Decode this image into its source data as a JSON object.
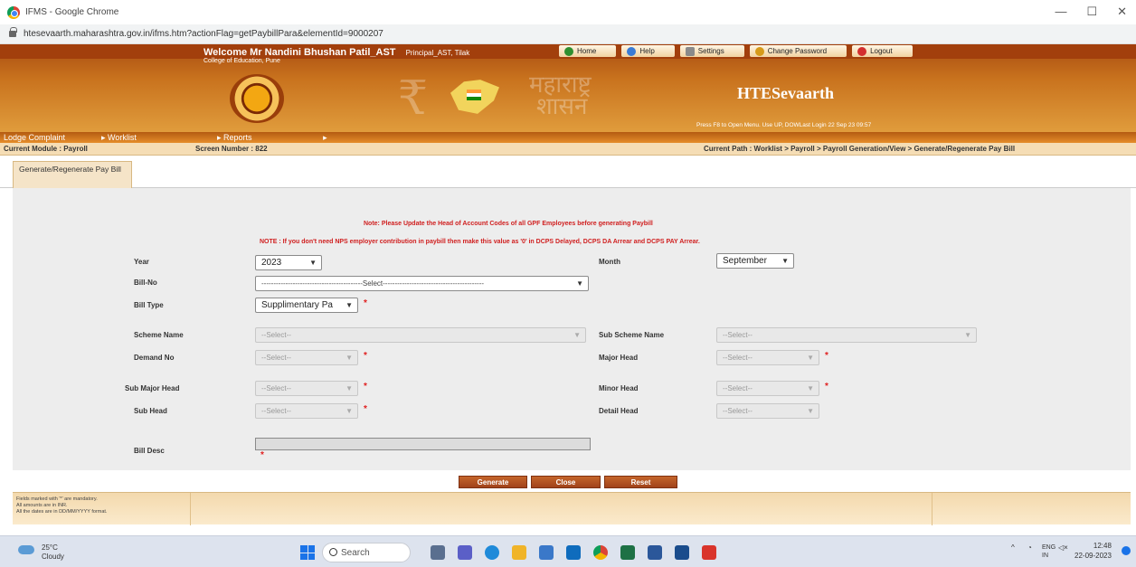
{
  "browser": {
    "window_title": "IFMS - Google Chrome",
    "url": "htesevaarth.maharashtra.gov.in/ifms.htm?actionFlag=getPaybillPara&elementId=9000207",
    "controls": [
      "—",
      "☐",
      "✕"
    ]
  },
  "header": {
    "welcome": "Welcome Mr Nandini Bhushan Patil_AST",
    "role": "Principal_AST, Tilak",
    "college": "College of Education, Pune",
    "deva_line1": "महाराष्ट्र",
    "deva_line2": "शासन",
    "brand": "HTESevaarth",
    "press_note": "Press F8 to Open Menu. Use UP, DOWLast Login 22 Sep 23 09:57",
    "nav": {
      "home": "Home",
      "help": "Help",
      "settings": "Settings",
      "change_password": "Change Password",
      "logout": "Logout"
    }
  },
  "menubar": {
    "lodge": "Lodge Complaint",
    "worklist": "Worklist",
    "reports": "Reports"
  },
  "modbar": {
    "module": "Current Module : Payroll",
    "screen": "Screen Number : 822",
    "path": "Current Path : Worklist > Payroll > Payroll Generation/View > Generate/Regenerate Pay Bill"
  },
  "tab": {
    "label": "Generate/Regenerate Pay Bill"
  },
  "notes": {
    "note1": "Note: Please Update the Head of Account Codes of all GPF Employees before generating Paybill",
    "note2": "NOTE : If you don't need NPS employer contribution in paybill then make this value as '0' in DCPS Delayed, DCPS DA Arrear and DCPS PAY Arrear."
  },
  "form": {
    "year_label": "Year",
    "year_value": "2023",
    "month_label": "Month",
    "month_value": "September",
    "billno_label": "Bill-No",
    "billno_value": "------------------------------------------Select------------------------------------------",
    "billtype_label": "Bill Type",
    "billtype_value": "Supplimentary Pa",
    "scheme_label": "Scheme Name",
    "scheme_value": "--Select--",
    "subscheme_label": "Sub Scheme Name",
    "subscheme_value": "--Select--",
    "demand_label": "Demand No",
    "demand_value": "--Select--",
    "majorhead_label": "Major Head",
    "majorhead_value": "--Select--",
    "submajor_label": "Sub Major Head",
    "submajor_value": "--Select--",
    "minorhead_label": "Minor Head",
    "minorhead_value": "--Select--",
    "subhead_label": "Sub Head",
    "subhead_value": "--Select--",
    "detailhead_label": "Detail Head",
    "detailhead_value": "--Select--",
    "billdesc_label": "Bill Desc",
    "required_mark": "*"
  },
  "buttons": {
    "generate": "Generate",
    "close": "Close",
    "reset": "Reset"
  },
  "footer": {
    "line1": "Fields marked with '*' are mandatory.",
    "line2": "All amounts are in INR.",
    "line3": "All the dates are in DD/MM/YYYY format."
  },
  "taskbar": {
    "temp": "25°C",
    "weather": "Cloudy",
    "search": "Search",
    "lang1": "ENG",
    "lang2": "IN",
    "time": "12:48",
    "date": "22-09-2023"
  },
  "colors": {
    "banner": "#c9731e",
    "menubar": "#b45b12",
    "note_red": "#d02020",
    "button": "#a0421a"
  }
}
